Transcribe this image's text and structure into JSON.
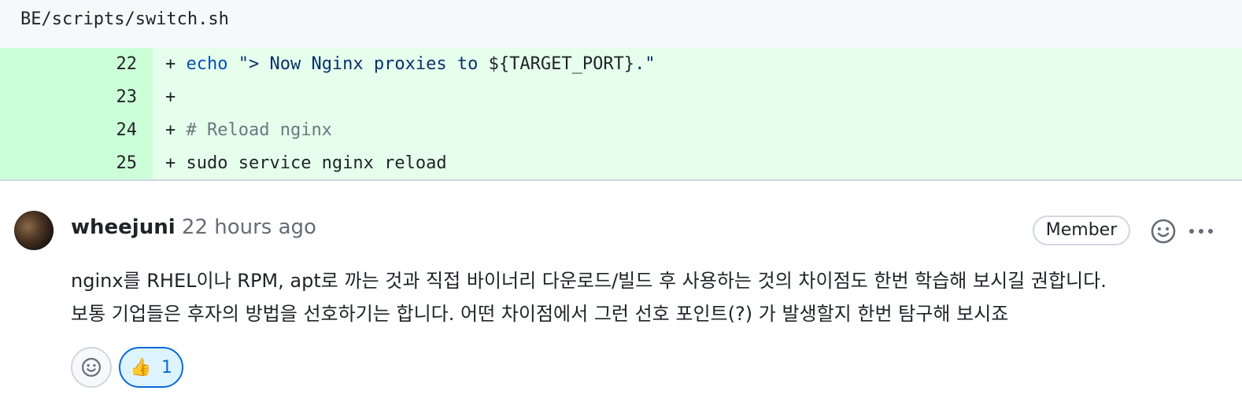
{
  "file": {
    "path": "BE/scripts/switch.sh"
  },
  "diff": {
    "lines": [
      {
        "num": "22",
        "prefix": "+ ",
        "kw": "echo",
        "str": " \"> Now Nginx proxies to ",
        "var": "${TARGET_PORT}",
        "end": ".\""
      },
      {
        "num": "23",
        "prefix": "+",
        "text": ""
      },
      {
        "num": "24",
        "prefix": "+ ",
        "comment": "# Reload nginx"
      },
      {
        "num": "25",
        "prefix": "+ ",
        "text": "sudo service nginx reload"
      }
    ]
  },
  "comment": {
    "author": "wheejuni",
    "time": "22 hours ago",
    "badge": "Member",
    "body": [
      "nginx를 RHEL이나 RPM, apt로 까는 것과 직접 바이너리 다운로드/빌드 후 사용하는 것의 차이점도 한번 학습해 보시길 권합니다.",
      "보통 기업들은 후자의 방법을 선호하기는 합니다. 어떤 차이점에서 그런 선호 포인트(?) 가 발생할지 한번 탐구해 보시죠"
    ],
    "reactions": [
      {
        "emoji": "👍",
        "count": "1"
      }
    ]
  },
  "icons": {
    "avatar": "avatar-image",
    "add_reaction": "smiley-icon",
    "more": "kebab-horizontal-icon"
  },
  "colors": {
    "added_line_bg": "#e6ffec",
    "added_num_bg": "#ccffd8",
    "accent": "#0969da"
  }
}
